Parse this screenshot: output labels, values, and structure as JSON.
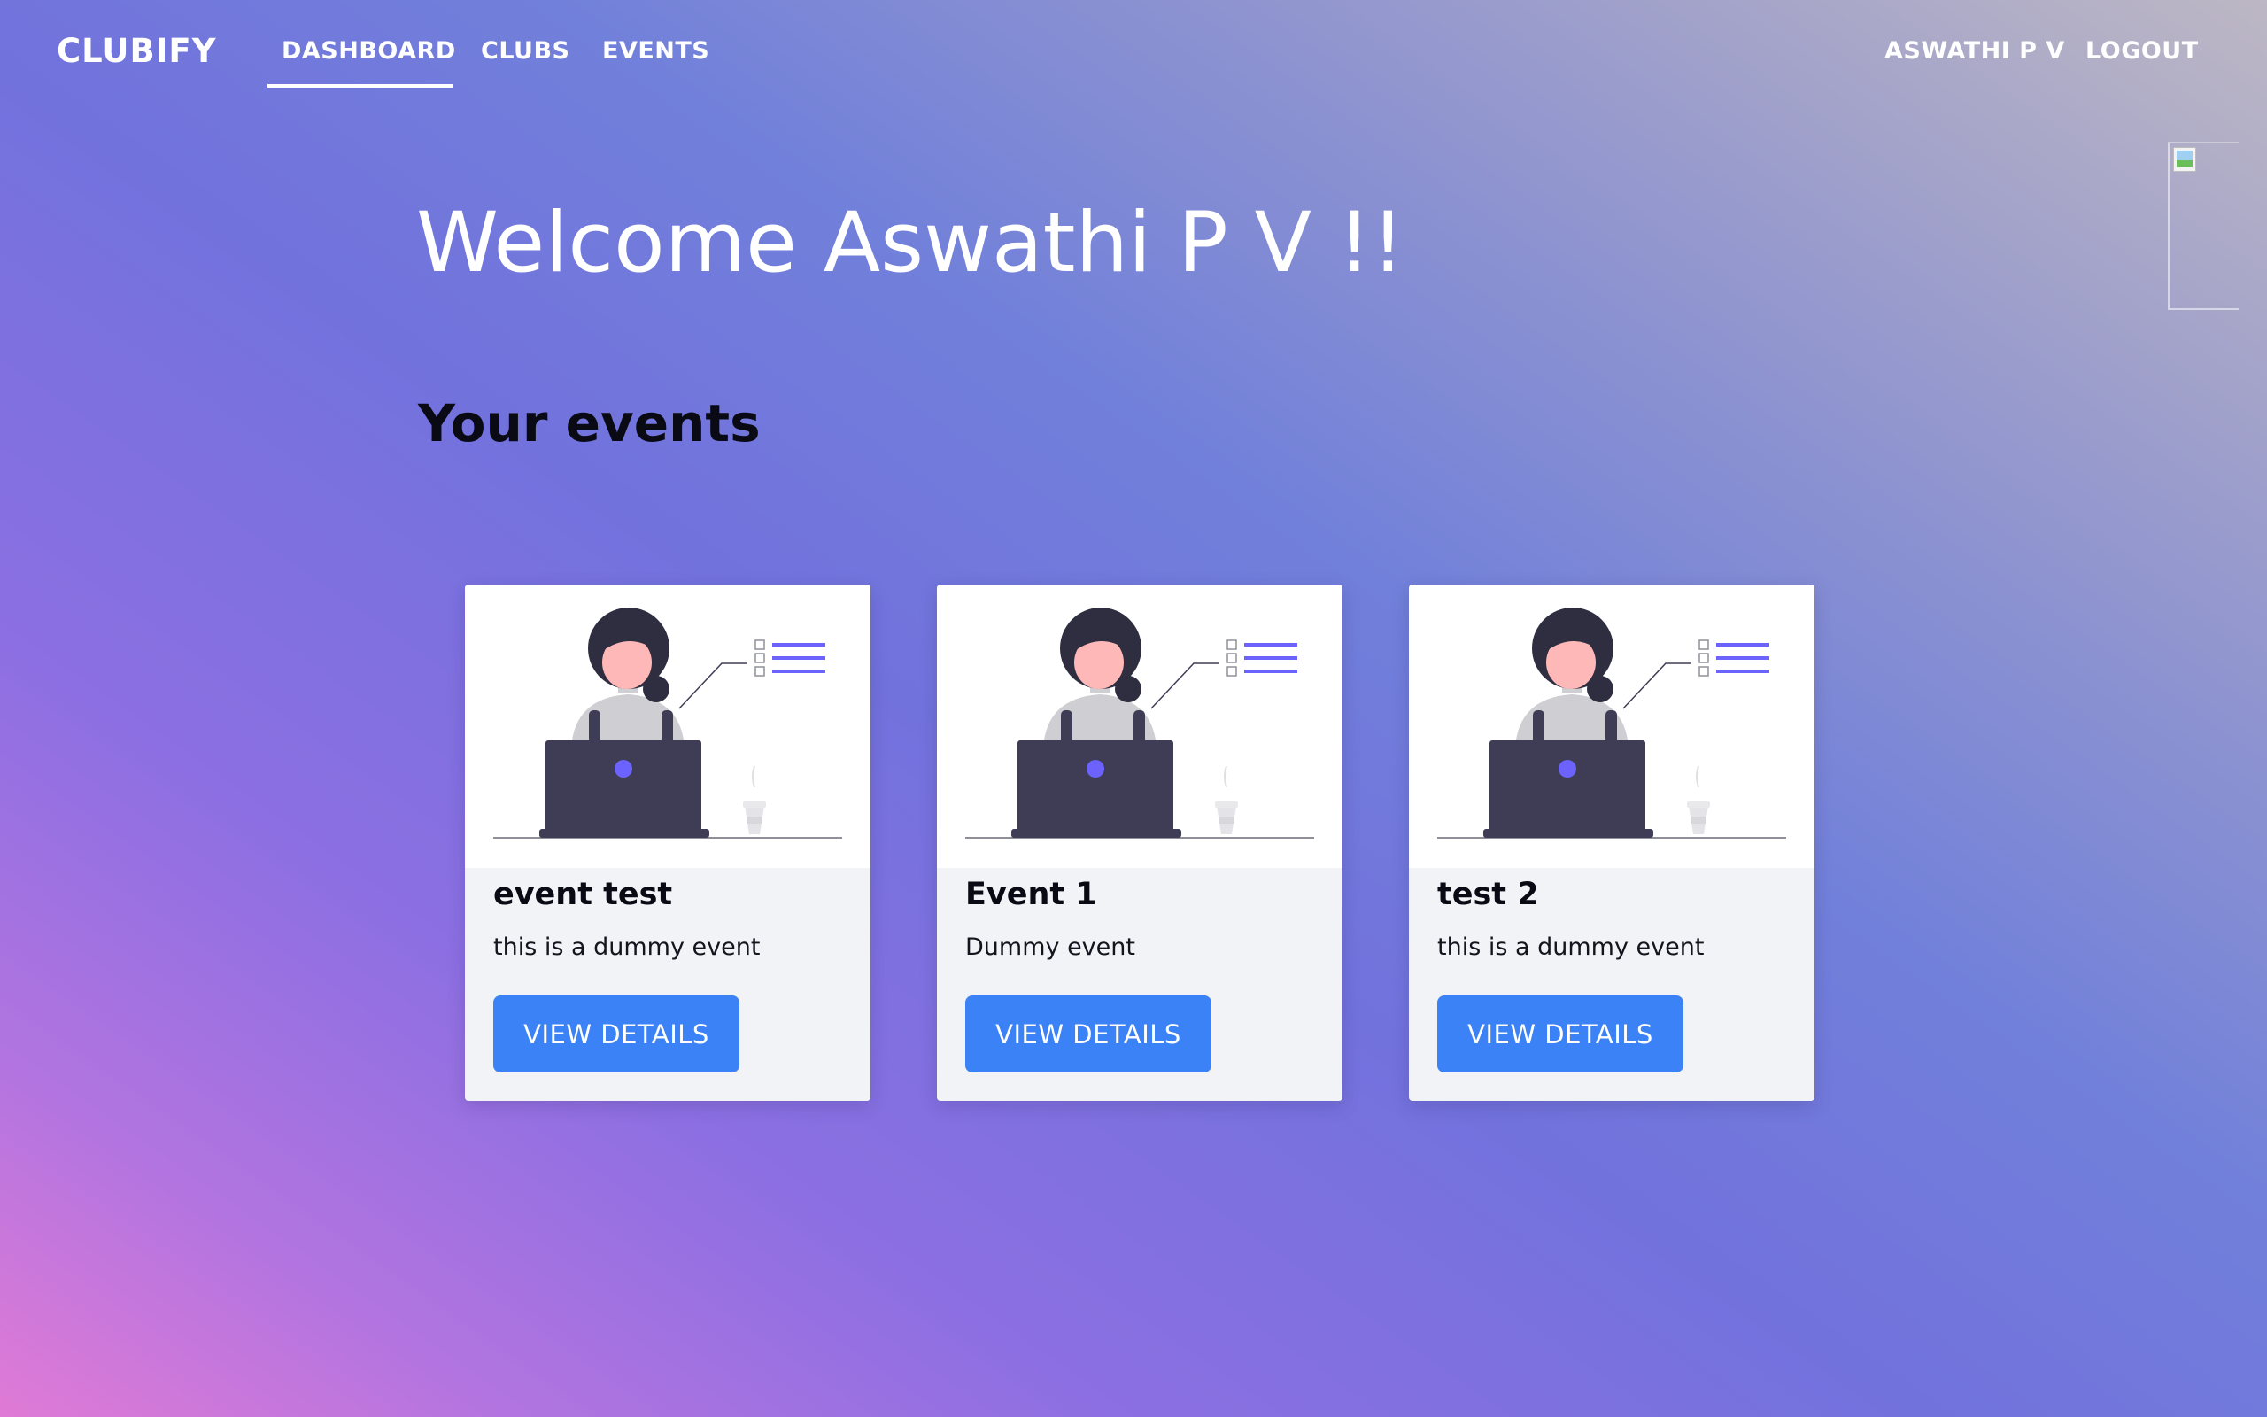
{
  "nav": {
    "brand": "CLUBIFY",
    "links": [
      "DASHBOARD",
      "CLUBS",
      "EVENTS"
    ],
    "active": "DASHBOARD",
    "user": "ASWATHI P V",
    "logout": "LOGOUT"
  },
  "welcome": "Welcome Aswathi P V !!",
  "events_section": {
    "title": "Your events",
    "cards": [
      {
        "title": "event test",
        "description": "this is a dummy event",
        "button": "VIEW DETAILS"
      },
      {
        "title": "Event 1",
        "description": "Dummy event",
        "button": "VIEW DETAILS"
      },
      {
        "title": "test 2",
        "description": "this is a dummy event",
        "button": "VIEW DETAILS"
      }
    ]
  },
  "colors": {
    "button": "#3b82f6",
    "illustration_accent": "#6c63ff",
    "laptop": "#3f3d56"
  },
  "icons": {
    "broken_image": "broken-image-icon",
    "card_illustration": "person-at-laptop-illustration"
  }
}
